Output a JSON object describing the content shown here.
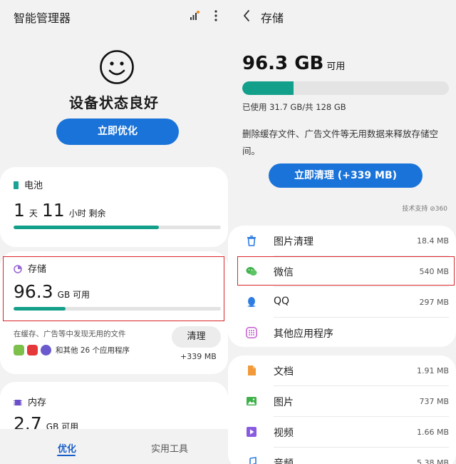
{
  "left": {
    "app_title": "智能管理器",
    "status_title": "设备状态良好",
    "optimize_button": "立即优化",
    "battery": {
      "label": "电池",
      "days": "1",
      "days_unit": "天",
      "hours": "11",
      "hours_unit": "小时 剩余",
      "level_fraction": 0.7
    },
    "storage": {
      "label": "存储",
      "value": "96.3",
      "unit": "GB 可用",
      "used_fraction": 0.25,
      "description": "在缓存、广告等中发现无用的文件",
      "apps_text": "和其他 26 个应用程序",
      "clean_button": "清理",
      "clean_size": "+339 MB"
    },
    "memory": {
      "label": "内存",
      "value": "2.7",
      "unit": "GB 可用"
    },
    "nav": {
      "optimize": "优化",
      "tools": "实用工具"
    }
  },
  "right": {
    "page_title": "存储",
    "available_value": "96.3 GB",
    "available_unit": "可用",
    "used_fraction": 0.248,
    "used_text": "已使用 31.7 GB/共 128 GB",
    "description": "删除缓存文件、广告文件等无用数据来释放存储空间。",
    "clean_all_button": "立即清理 (+339 MB)",
    "tech_support": "技术支持 ⊘360",
    "group_a": [
      {
        "label": "图片清理",
        "size": "18.4 MB",
        "icon": "trash-icon"
      },
      {
        "label": "微信",
        "size": "540 MB",
        "icon": "wechat-icon"
      },
      {
        "label": "QQ",
        "size": "297 MB",
        "icon": "qq-icon"
      },
      {
        "label": "其他应用程序",
        "size": "",
        "icon": "apps-grid-icon"
      }
    ],
    "group_b": [
      {
        "label": "文档",
        "size": "1.91 MB",
        "icon": "document-icon"
      },
      {
        "label": "图片",
        "size": "737 MB",
        "icon": "image-icon"
      },
      {
        "label": "视频",
        "size": "1.66 MB",
        "icon": "video-icon"
      },
      {
        "label": "音频",
        "size": "5.38 MB",
        "icon": "audio-icon"
      }
    ]
  },
  "colors": {
    "accent_blue": "#1a73d9",
    "progress_teal": "#12a08a",
    "highlight_red": "#d9262a"
  }
}
